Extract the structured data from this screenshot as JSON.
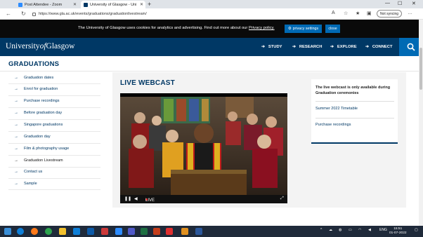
{
  "browser": {
    "tabs": [
      {
        "title": "Post Attendee - Zoom",
        "icon": "zoom-icon",
        "color": "#2d8cff"
      },
      {
        "title": "University of Glasgow - Uni",
        "icon": "uog-icon",
        "color": "#003865",
        "active": true
      }
    ],
    "url": "https://www.gla.ac.uk/events/graduations/graduationlivestream/",
    "profile_label": "Not syncing"
  },
  "cookie_banner": {
    "text": "The University of Glasgow uses cookies for analytics and advertising. Find out more about our",
    "link": "Privacy policy.",
    "privacy_button": "privacy settings",
    "close_button": "close"
  },
  "header": {
    "logo_main": "University",
    "logo_of": "of",
    "logo_end": "Glasgow",
    "nav": [
      "STUDY",
      "RESEARCH",
      "EXPLORE",
      "CONNECT"
    ],
    "brand_color": "#003865",
    "accent_color": "#006ab4"
  },
  "page_title": "GRADUATIONS",
  "sidebar": {
    "items": [
      {
        "label": "Graduation dates"
      },
      {
        "label": "Enrol for graduation"
      },
      {
        "label": "Purchase recordings"
      },
      {
        "label": "Before graduation day"
      },
      {
        "label": "Singapore graduations"
      },
      {
        "label": "Graduation day"
      },
      {
        "label": "Film & photography usage"
      },
      {
        "label": "Graduation Livestream",
        "active": true
      },
      {
        "label": "Contact us"
      },
      {
        "label": "Sample"
      }
    ]
  },
  "main": {
    "heading": "LIVE WEBCAST",
    "video": {
      "live_label": "LIVE"
    }
  },
  "right_card": {
    "note": "The live webcast is only available during Graduation ceremonies",
    "links": [
      "Summer 2022 Timetable",
      "Purchase recordings"
    ]
  },
  "taskbar": {
    "time": "15:51",
    "date": "01-07-2022",
    "lang": "ENG"
  }
}
